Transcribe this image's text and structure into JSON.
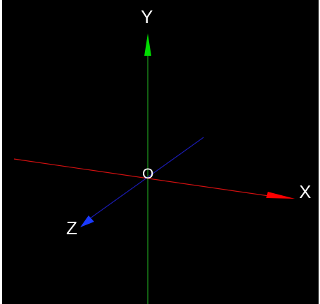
{
  "scene": {
    "background": "#000000",
    "origin_label": "O",
    "axes": [
      {
        "name": "X",
        "color": "#ff0000",
        "label": "X"
      },
      {
        "name": "Y",
        "color": "#00cc00",
        "label": "Y"
      },
      {
        "name": "Z",
        "color": "#0000ff",
        "label": "Z"
      }
    ]
  }
}
